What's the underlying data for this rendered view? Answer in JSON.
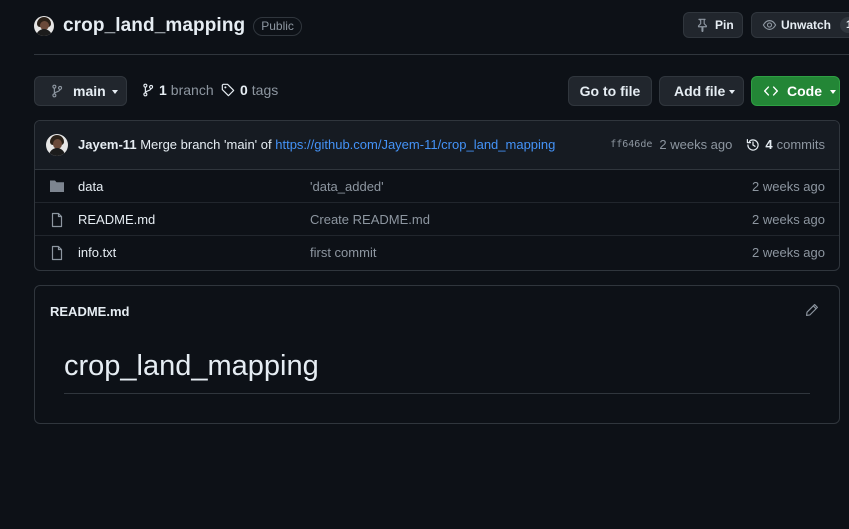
{
  "repo": {
    "name": "crop_land_mapping",
    "visibility": "Public"
  },
  "header_actions": {
    "pin_label": "Pin",
    "unwatch_label": "Unwatch",
    "watch_count": "1"
  },
  "toolbar": {
    "branch": "main",
    "branch_count": "1",
    "branch_label": "branch",
    "tag_count": "0",
    "tag_label": "tags",
    "goto_file_label": "Go to file",
    "add_file_label": "Add file",
    "code_label": "Code"
  },
  "latest_commit": {
    "author": "Jayem-11",
    "message": "Merge branch 'main' of",
    "link": "https://github.com/Jayem-11/crop_land_mapping",
    "sha": "ff646de",
    "time": "2 weeks ago",
    "commit_count": "4",
    "commits_label": "commits"
  },
  "files": [
    {
      "name": "data",
      "type": "folder",
      "message": "'data_added'",
      "time": "2 weeks ago"
    },
    {
      "name": "README.md",
      "type": "file",
      "message": "Create README.md",
      "time": "2 weeks ago"
    },
    {
      "name": "info.txt",
      "type": "file",
      "message": "first commit",
      "time": "2 weeks ago"
    }
  ],
  "readme": {
    "filename": "README.md",
    "heading": "crop_land_mapping"
  },
  "colors": {
    "background": "#0d1117",
    "border": "#30363d",
    "link": "#4493f8",
    "code_button": "#238636",
    "muted_text": "#8d96a0"
  },
  "icons": [
    "repo-avatar",
    "pin-icon",
    "eye-icon",
    "git-branch-icon",
    "tag-icon",
    "code-icon",
    "history-icon",
    "folder-icon",
    "file-icon",
    "pencil-icon"
  ]
}
